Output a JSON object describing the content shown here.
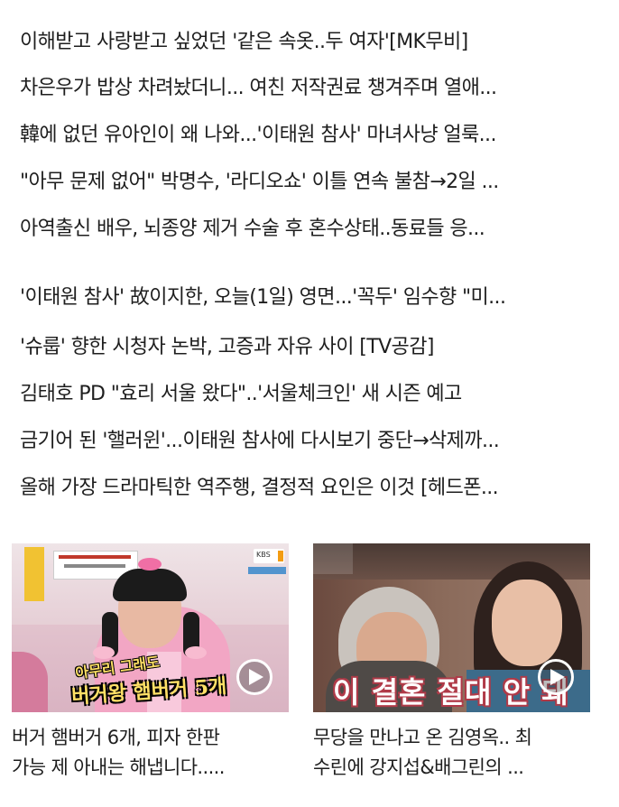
{
  "headlines": [
    "이해받고 사랑받고 싶었던 '같은 속옷..두 여자'[MK무비]",
    "차은우가 밥상 차려놨더니... 여친 저작권료 챙겨주며 열애...",
    "韓에 없던 유아인이 왜 나와...'이태원 참사' 마녀사냥 얼룩...",
    "\"아무 문제 없어\" 박명수, '라디오쇼' 이틀 연속 불참→2일 ...",
    "아역출신 배우, 뇌종양 제거 수술 후 혼수상태..동료들 응...",
    "'이태원 참사' 故이지한, 오늘(1일) 영면...'꼭두' 임수향 \"미...",
    "'슈룹' 향한 시청자 논박, 고증과 자유 사이 [TV공감]",
    "김태호 PD \"효리 서울 왔다\"..'서울체크인' 새 시즌 예고",
    "금기어 된 '핼러윈'...이태원 참사에 다시보기 중단→삭제까...",
    "올해 가장 드라마틱한 역주행, 결정적 요인은 이것 [헤드폰..."
  ],
  "videos": [
    {
      "caption_line1": "버거 햄버거 6개, 피자 한판",
      "caption_line2": "가능 제 아내는 해냅니다.....",
      "thumb_subtitle": "버거왕 햄버거 5개",
      "thumb_subtitle_top": "아무리 그래도",
      "channel_badge": "KBS"
    },
    {
      "caption_line1": "무당을 만나고 온 김영옥.. 최",
      "caption_line2": "수린에 강지섭&배그린의 ...",
      "thumb_subtitle": "이 결혼 절대 안 돼"
    }
  ]
}
